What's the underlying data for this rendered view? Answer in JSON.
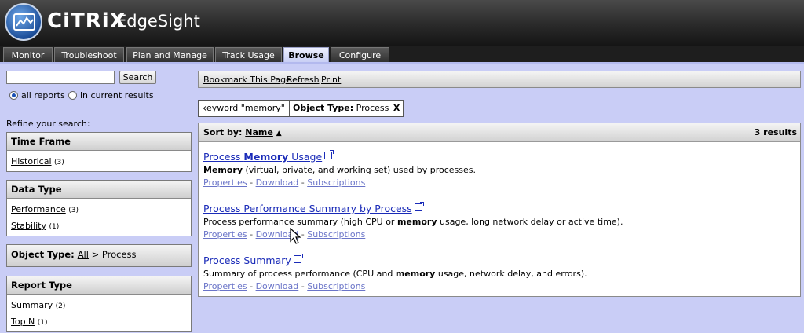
{
  "brand": {
    "logo_text": "CiTRiX",
    "product": "EdgeSight"
  },
  "tabs": [
    {
      "label": "Monitor"
    },
    {
      "label": "Troubleshoot"
    },
    {
      "label": "Plan and Manage"
    },
    {
      "label": "Track Usage"
    },
    {
      "label": "Browse",
      "active": true
    },
    {
      "label": "Configure"
    }
  ],
  "search": {
    "value": "",
    "button": "Search",
    "radio_all": "all reports",
    "radio_current": "in current results",
    "selected": "all reports"
  },
  "refine_label": "Refine your search:",
  "facets": {
    "time_frame": {
      "title": "Time Frame",
      "items": [
        {
          "label": "Historical",
          "count": "(3)"
        }
      ]
    },
    "data_type": {
      "title": "Data Type",
      "items": [
        {
          "label": "Performance",
          "count": "(3)"
        },
        {
          "label": "Stability",
          "count": "(1)"
        }
      ]
    },
    "object_type": {
      "prefix": "Object Type: ",
      "all_link": "All",
      "suffix": " > Process"
    },
    "report_type": {
      "title": "Report Type",
      "items": [
        {
          "label": "Summary",
          "count": "(2)"
        },
        {
          "label": "Top N",
          "count": "(1)"
        }
      ]
    }
  },
  "toolbar": {
    "bookmark": "Bookmark This Page",
    "refresh": "Refresh",
    "print": "Print"
  },
  "chips": [
    {
      "label": "keyword \"memory\"",
      "remove": "X"
    },
    {
      "label_bold": "Object Type:",
      "label": " Process",
      "remove": "X"
    }
  ],
  "results": {
    "sort_label": "Sort by:",
    "sort_field": "Name",
    "sort_arrow": "▲",
    "total": "3 results",
    "items": [
      {
        "title_pre": "Process ",
        "title_bold": "Memory",
        "title_post": " Usage",
        "desc_bold": "Memory",
        "desc_rest": " (virtual, private, and working set) used by processes.",
        "links": [
          "Properties",
          "Download",
          "Subscriptions"
        ]
      },
      {
        "title": "Process Performance Summary by Process",
        "desc_pre": "Process performance summary (high CPU or ",
        "desc_bold": "memory",
        "desc_post": " usage, long network delay or active time).",
        "links": [
          "Properties",
          "Download",
          "Subscriptions"
        ]
      },
      {
        "title": "Process Summary",
        "desc_pre": "Summary of process performance (CPU and ",
        "desc_bold": "memory",
        "desc_post": " usage, network delay, and errors).",
        "links": [
          "Properties",
          "Download",
          "Subscriptions"
        ]
      }
    ]
  },
  "colors": {
    "background": "#c9cdf6",
    "link": "#1a2bb8",
    "sublink": "#6a74c8",
    "header": "#2a2a2a"
  },
  "icons": [
    "citrix-logo-icon",
    "external-link-icon",
    "sort-ascending-icon",
    "mouse-pointer-icon"
  ]
}
